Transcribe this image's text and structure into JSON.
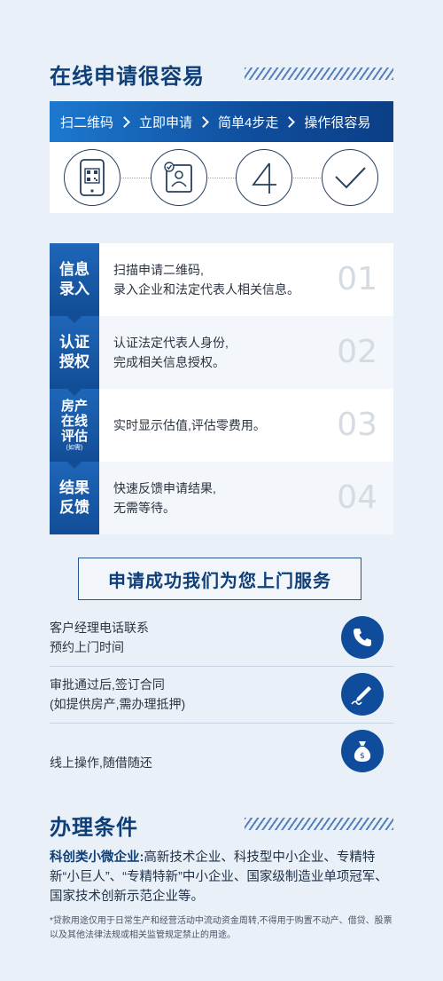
{
  "section1": {
    "title": "在线申请很容易"
  },
  "banner": {
    "steps": [
      "扫二维码",
      "立即申请",
      "简单4步走",
      "操作很容易"
    ]
  },
  "icons": [
    "phone-qr-icon",
    "id-card-icon",
    "number-four-icon",
    "checkmark-icon"
  ],
  "steps": [
    {
      "label_lines": [
        "信息",
        "录入"
      ],
      "text_lines": [
        "扫描申请二维码,",
        "录入企业和法定代表人相关信息。"
      ],
      "number": "01"
    },
    {
      "label_lines": [
        "认证",
        "授权"
      ],
      "text_lines": [
        "认证法定代表人身份,",
        "完成相关信息授权。"
      ],
      "number": "02"
    },
    {
      "label_lines": [
        "房产",
        "在线",
        "评估"
      ],
      "label_note": "(如需)",
      "text_lines": [
        "实时显示估值,评估零费用。"
      ],
      "number": "03"
    },
    {
      "label_lines": [
        "结果",
        "反馈"
      ],
      "text_lines": [
        "快速反馈申请结果,",
        "无需等待。"
      ],
      "number": "04"
    }
  ],
  "service": {
    "title": "申请成功我们为您上门服务",
    "items": [
      {
        "lines": [
          "客户经理电话联系",
          "预约上门时间"
        ],
        "icon": "phone-icon"
      },
      {
        "lines": [
          "审批通过后,签订合同",
          "(如提供房产,需办理抵押)"
        ],
        "icon": "pen-sign-icon"
      },
      {
        "lines": [
          "线上操作,随借随还"
        ],
        "icon": "money-bag-icon"
      }
    ]
  },
  "conditions": {
    "title": "办理条件",
    "highlight": "科创类小微企业:",
    "text": "高新技术企业、科技型中小企业、专精特新“小巨人”、“专精特新”中小企业、国家级制造业单项冠军、国家技术创新示范企业等。",
    "footnote": "*贷款用途仅用于日常生产和经营活动中流动资金周转,不得用于购置不动产、借贷、股票以及其他法律法规或相关监管规定禁止的用途。"
  },
  "colors": {
    "primary": "#0f4d9c",
    "accent": "#1c79cf",
    "background": "#e9f0f8"
  }
}
